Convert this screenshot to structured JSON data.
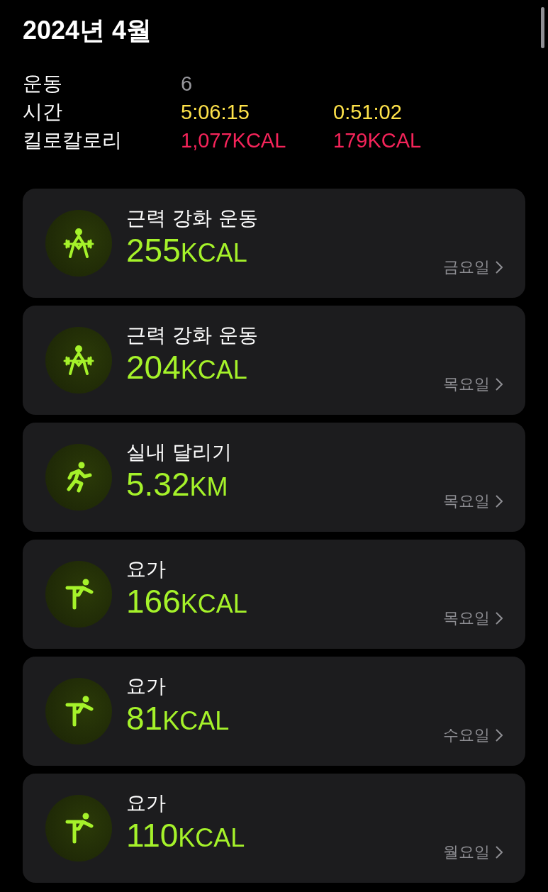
{
  "title": "2024년 4월",
  "summary": [
    {
      "label": "운동",
      "kind": "count",
      "values": [
        "6"
      ]
    },
    {
      "label": "시간",
      "kind": "time",
      "values": [
        "5:06:15",
        "0:51:02"
      ]
    },
    {
      "label": "킬로칼로리",
      "kind": "energy",
      "values": [
        "1,077KCAL",
        "179KCAL"
      ]
    }
  ],
  "workouts": [
    {
      "kind": "strength",
      "name": "근력 강화 운동",
      "value": "255",
      "unit": "KCAL",
      "day": "금요일"
    },
    {
      "kind": "strength",
      "name": "근력 강화 운동",
      "value": "204",
      "unit": "KCAL",
      "day": "목요일"
    },
    {
      "kind": "running",
      "name": "실내 달리기",
      "value": "5.32",
      "unit": "KM",
      "day": "목요일"
    },
    {
      "kind": "yoga",
      "name": "요가",
      "value": "166",
      "unit": "KCAL",
      "day": "목요일"
    },
    {
      "kind": "yoga",
      "name": "요가",
      "value": "81",
      "unit": "KCAL",
      "day": "수요일"
    },
    {
      "kind": "yoga",
      "name": "요가",
      "value": "110",
      "unit": "KCAL",
      "day": "월요일"
    }
  ]
}
